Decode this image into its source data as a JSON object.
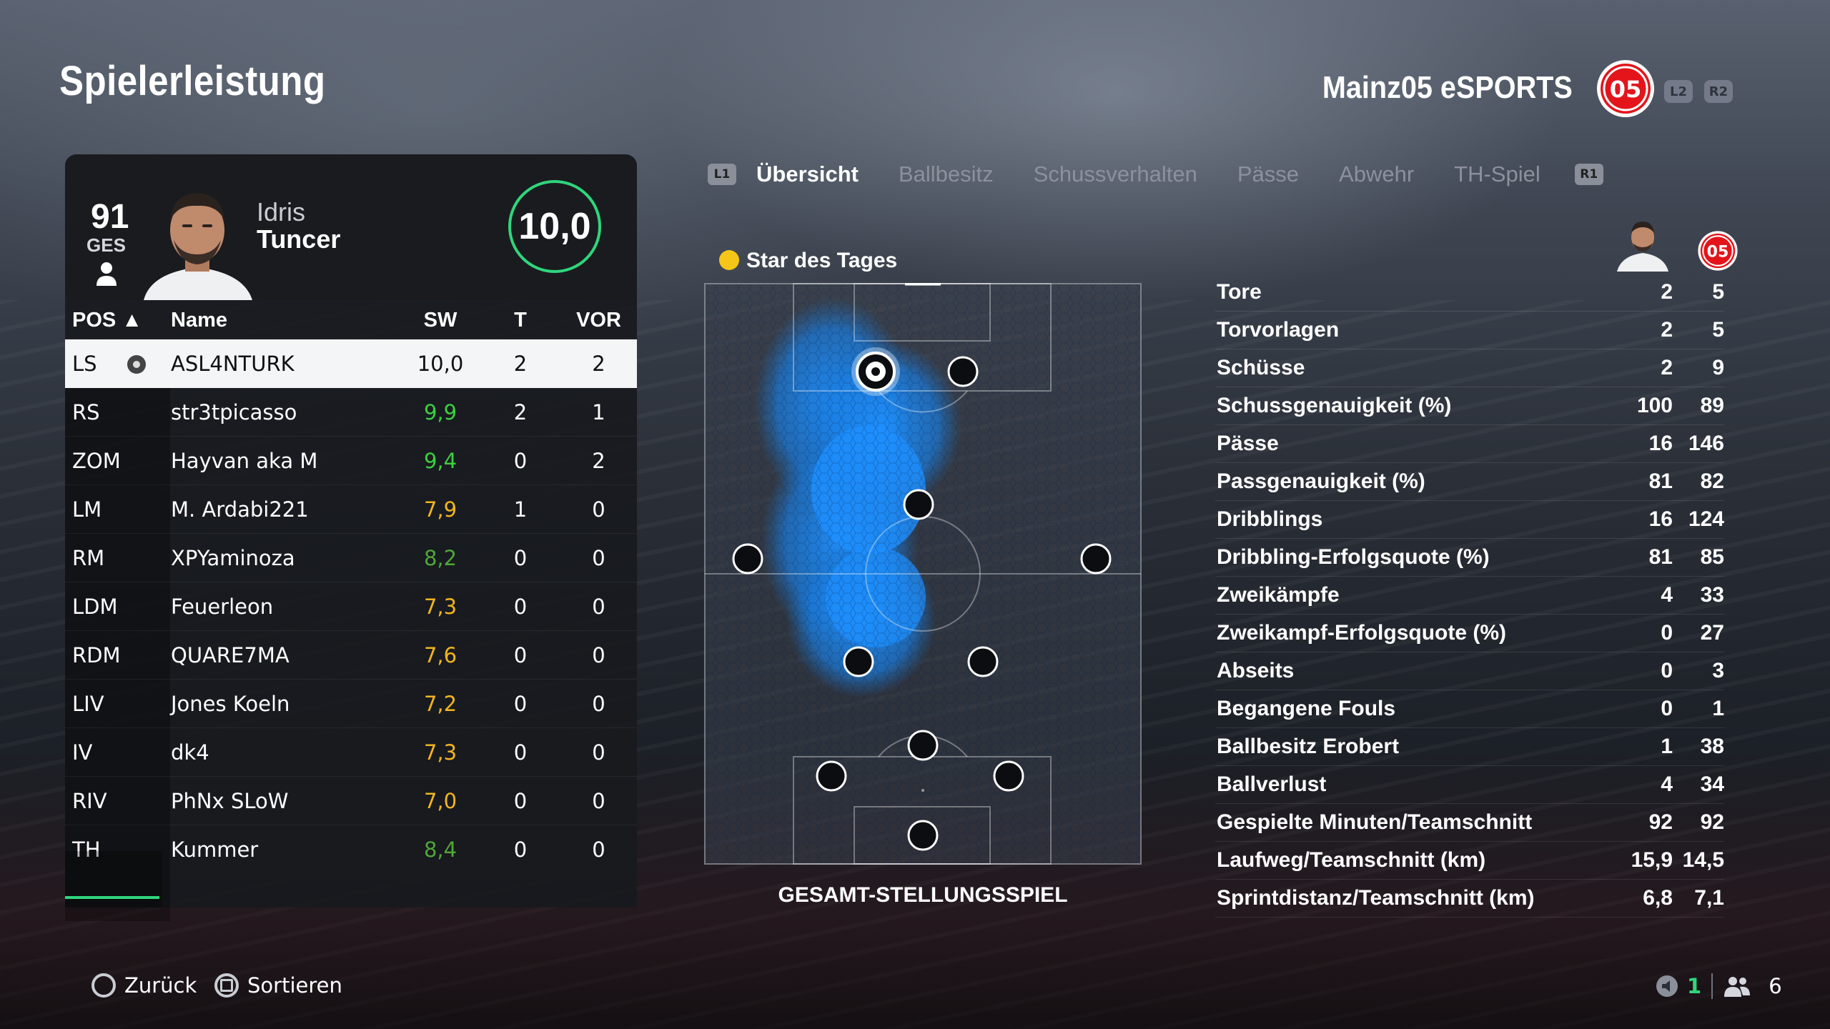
{
  "page_title": "Spielerleistung",
  "team": {
    "name": "Mainz05 eSPORTS",
    "l2": "L2",
    "r2": "R2",
    "accent": "#e3151b"
  },
  "player": {
    "overall": "91",
    "overall_label": "GES",
    "first_name": "Idris",
    "last_name": "Tuncer",
    "rating": "10,0"
  },
  "table": {
    "headers": {
      "pos": "POS ▲",
      "name": "Name",
      "sw": "SW",
      "t": "T",
      "vor": "VOR"
    },
    "rows": [
      {
        "pos": "LS",
        "name": "ASL4NTURK",
        "sw": "10,0",
        "t": "2",
        "vor": "2",
        "sw_color": "#111111",
        "ball": true
      },
      {
        "pos": "RS",
        "name": "str3tpicasso",
        "sw": "9,9",
        "t": "2",
        "vor": "1",
        "sw_color": "#3ad13e"
      },
      {
        "pos": "ZOM",
        "name": "Hayvan aka M",
        "sw": "9,4",
        "t": "0",
        "vor": "2",
        "sw_color": "#3ad13e"
      },
      {
        "pos": "LM",
        "name": "M. Ardabi221",
        "sw": "7,9",
        "t": "1",
        "vor": "0",
        "sw_color": "#f2b51d"
      },
      {
        "pos": "RM",
        "name": "XPYaminoza",
        "sw": "8,2",
        "t": "0",
        "vor": "0",
        "sw_color": "#4fa73a"
      },
      {
        "pos": "LDM",
        "name": "Feuerleon",
        "sw": "7,3",
        "t": "0",
        "vor": "0",
        "sw_color": "#f2b51d"
      },
      {
        "pos": "RDM",
        "name": "QUARE7MA",
        "sw": "7,6",
        "t": "0",
        "vor": "0",
        "sw_color": "#f2b51d"
      },
      {
        "pos": "LIV",
        "name": "Jones Koeln",
        "sw": "7,2",
        "t": "0",
        "vor": "0",
        "sw_color": "#f2b51d"
      },
      {
        "pos": "IV",
        "name": "dk4",
        "sw": "7,3",
        "t": "0",
        "vor": "0",
        "sw_color": "#f2b51d"
      },
      {
        "pos": "RIV",
        "name": "PhNx SLoW",
        "sw": "7,0",
        "t": "0",
        "vor": "0",
        "sw_color": "#f2b51d"
      },
      {
        "pos": "TH",
        "name": "Kummer",
        "sw": "8,4",
        "t": "0",
        "vor": "0",
        "sw_color": "#4fa73a"
      }
    ]
  },
  "tabs": {
    "l1": "L1",
    "r1": "R1",
    "items": [
      "Übersicht",
      "Ballbesitz",
      "Schussverhalten",
      "Pässe",
      "Abwehr",
      "TH-Spiel"
    ],
    "active": 0
  },
  "star_label": "Star des Tages",
  "pitch_caption": "GESAMT-STELLUNGSSPIEL",
  "stats": [
    {
      "label": "Tore",
      "player": "2",
      "team": "5"
    },
    {
      "label": "Torvorlagen",
      "player": "2",
      "team": "5"
    },
    {
      "label": "Schüsse",
      "player": "2",
      "team": "9"
    },
    {
      "label": "Schussgenauigkeit (%)",
      "player": "100",
      "team": "89"
    },
    {
      "label": "Pässe",
      "player": "16",
      "team": "146"
    },
    {
      "label": "Passgenauigkeit (%)",
      "player": "81",
      "team": "82"
    },
    {
      "label": "Dribblings",
      "player": "16",
      "team": "124"
    },
    {
      "label": "Dribbling-Erfolgsquote (%)",
      "player": "81",
      "team": "85"
    },
    {
      "label": "Zweikämpfe",
      "player": "4",
      "team": "33"
    },
    {
      "label": "Zweikampf-Erfolgsquote (%)",
      "player": "0",
      "team": "27"
    },
    {
      "label": "Abseits",
      "player": "0",
      "team": "3"
    },
    {
      "label": "Begangene Fouls",
      "player": "0",
      "team": "1"
    },
    {
      "label": "Ballbesitz Erobert",
      "player": "1",
      "team": "38"
    },
    {
      "label": "Ballverlust",
      "player": "4",
      "team": "34"
    },
    {
      "label": "Gespielte Minuten/Teamschnitt",
      "player": "92",
      "team": "92"
    },
    {
      "label": "Laufweg/Teamschnitt (km)",
      "player": "15,9",
      "team": "14,5"
    },
    {
      "label": "Sprintdistanz/Teamschnitt (km)",
      "player": "6,8",
      "team": "7,1"
    }
  ],
  "footer": {
    "back": "Zurück",
    "sort": "Sortieren",
    "count_a": "1",
    "count_b": "6"
  }
}
